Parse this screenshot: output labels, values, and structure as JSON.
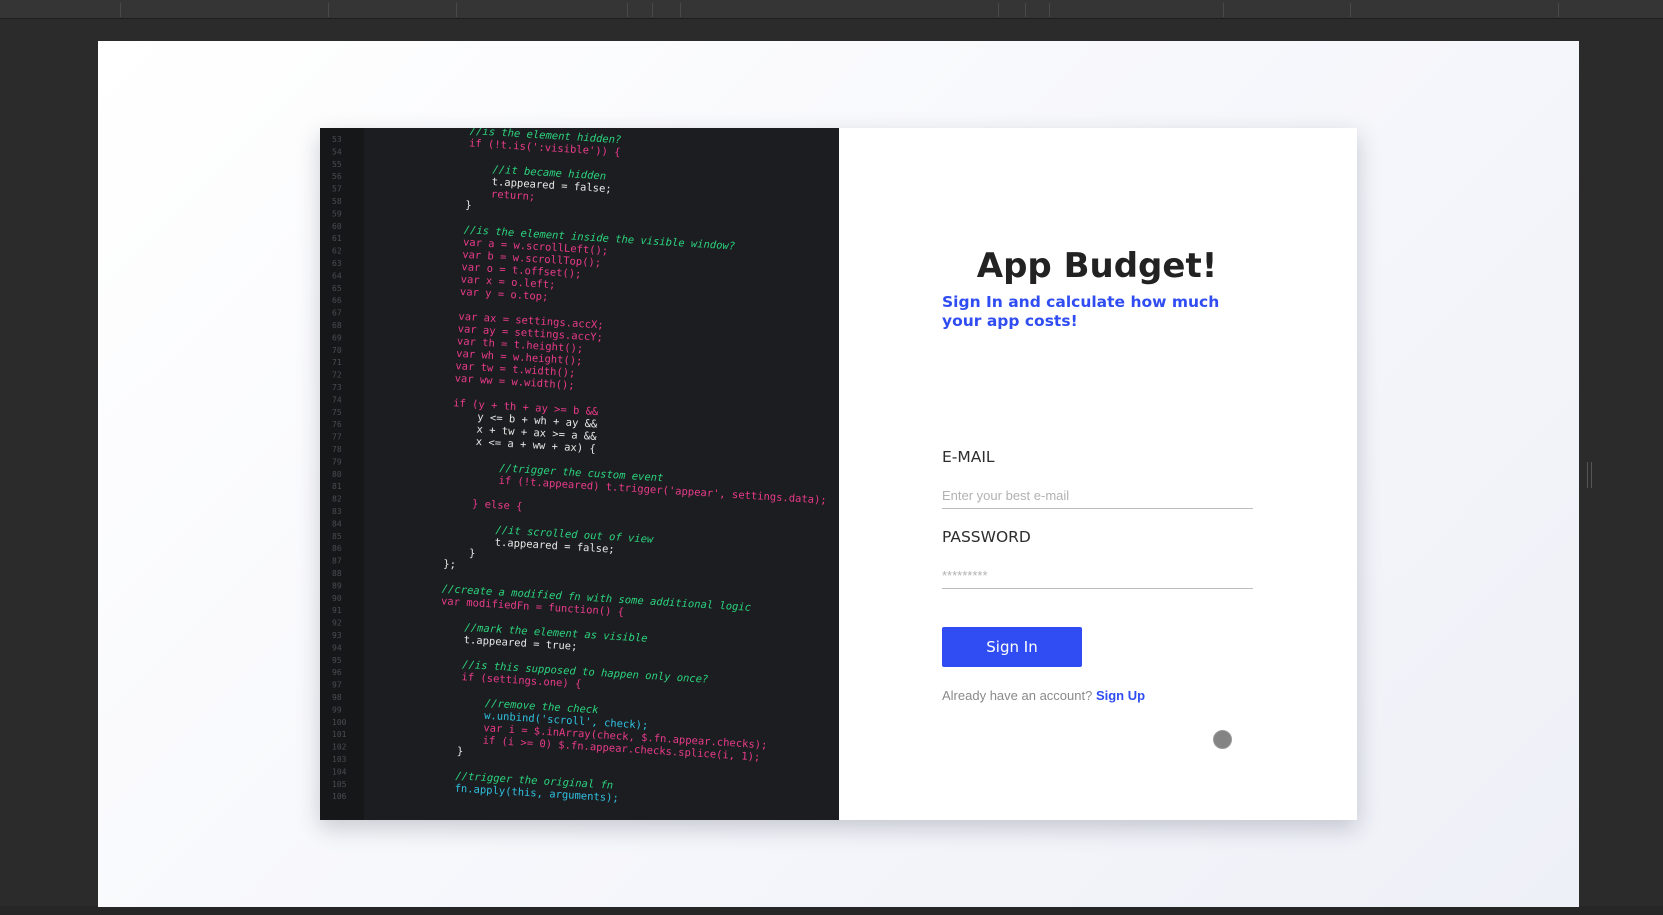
{
  "login": {
    "title": "App Budget!",
    "subtitle": "Sign In and calculate how much your app costs!",
    "email_label": "E-MAIL",
    "email_placeholder": "Enter your best e-mail",
    "email_value": "",
    "password_label": "PASSWORD",
    "password_placeholder": "*********",
    "password_value": "",
    "submit_label": "Sign In",
    "footer_text": "Already have an account?",
    "footer_link": "Sign Up"
  },
  "code_image": {
    "description_icon": "code-screenshot",
    "lines": [
      {
        "t": "//is the element hidden?",
        "c": "cm",
        "i": 0
      },
      {
        "t": "if (!t.is(':visible')) {",
        "c": "kw",
        "i": 0
      },
      {
        "t": "",
        "c": "tx",
        "i": 0
      },
      {
        "t": "//it became hidden",
        "c": "cm",
        "i": 1
      },
      {
        "t": "t.appeared = false;",
        "c": "tx",
        "i": 1
      },
      {
        "t": "return;",
        "c": "kw",
        "i": 1
      },
      {
        "t": "}",
        "c": "tx",
        "i": 0
      },
      {
        "t": "",
        "c": "tx",
        "i": 0
      },
      {
        "t": "//is the element inside the visible window?",
        "c": "cm",
        "i": 0
      },
      {
        "t": "var a = w.scrollLeft();",
        "c": "kw",
        "i": 0
      },
      {
        "t": "var b = w.scrollTop();",
        "c": "kw",
        "i": 0
      },
      {
        "t": "var o = t.offset();",
        "c": "kw",
        "i": 0
      },
      {
        "t": "var x = o.left;",
        "c": "kw",
        "i": 0
      },
      {
        "t": "var y = o.top;",
        "c": "kw",
        "i": 0
      },
      {
        "t": "",
        "c": "tx",
        "i": 0
      },
      {
        "t": "var ax = settings.accX;",
        "c": "kw",
        "i": 0
      },
      {
        "t": "var ay = settings.accY;",
        "c": "kw",
        "i": 0
      },
      {
        "t": "var th = t.height();",
        "c": "kw",
        "i": 0
      },
      {
        "t": "var wh = w.height();",
        "c": "kw",
        "i": 0
      },
      {
        "t": "var tw = t.width();",
        "c": "kw",
        "i": 0
      },
      {
        "t": "var ww = w.width();",
        "c": "kw",
        "i": 0
      },
      {
        "t": "",
        "c": "tx",
        "i": 0
      },
      {
        "t": "if (y + th + ay >= b &&",
        "c": "kw",
        "i": 0
      },
      {
        "t": "y <= b + wh + ay &&",
        "c": "tx",
        "i": 1
      },
      {
        "t": "x + tw + ax >= a &&",
        "c": "tx",
        "i": 1
      },
      {
        "t": "x <= a + ww + ax) {",
        "c": "tx",
        "i": 1
      },
      {
        "t": "",
        "c": "tx",
        "i": 0
      },
      {
        "t": "//trigger the custom event",
        "c": "cm",
        "i": 2
      },
      {
        "t": "if (!t.appeared) t.trigger('appear', settings.data);",
        "c": "kw",
        "i": 2
      },
      {
        "t": "",
        "c": "tx",
        "i": 0
      },
      {
        "t": "} else {",
        "c": "kw",
        "i": 1
      },
      {
        "t": "",
        "c": "tx",
        "i": 0
      },
      {
        "t": "//it scrolled out of view",
        "c": "cm",
        "i": 2
      },
      {
        "t": "t.appeared = false;",
        "c": "tx",
        "i": 2
      },
      {
        "t": "}",
        "c": "tx",
        "i": 1
      },
      {
        "t": "};",
        "c": "tx",
        "i": 0
      },
      {
        "t": "",
        "c": "tx",
        "i": 0
      },
      {
        "t": "//create a modified fn with some additional logic",
        "c": "cm",
        "i": 0
      },
      {
        "t": "var modifiedFn = function() {",
        "c": "kw",
        "i": 0
      },
      {
        "t": "",
        "c": "tx",
        "i": 0
      },
      {
        "t": "//mark the element as visible",
        "c": "cm",
        "i": 1
      },
      {
        "t": "t.appeared = true;",
        "c": "tx",
        "i": 1
      },
      {
        "t": "",
        "c": "tx",
        "i": 0
      },
      {
        "t": "//is this supposed to happen only once?",
        "c": "cm",
        "i": 1
      },
      {
        "t": "if (settings.one) {",
        "c": "kw",
        "i": 1
      },
      {
        "t": "",
        "c": "tx",
        "i": 0
      },
      {
        "t": "//remove the check",
        "c": "cm",
        "i": 2
      },
      {
        "t": "w.unbind('scroll', check);",
        "c": "fn",
        "i": 2
      },
      {
        "t": "var i = $.inArray(check, $.fn.appear.checks);",
        "c": "kw",
        "i": 2
      },
      {
        "t": "if (i >= 0) $.fn.appear.checks.splice(i, 1);",
        "c": "kw",
        "i": 2
      },
      {
        "t": "}",
        "c": "tx",
        "i": 1
      },
      {
        "t": "",
        "c": "tx",
        "i": 0
      },
      {
        "t": "//trigger the original fn",
        "c": "cm",
        "i": 1
      },
      {
        "t": "fn.apply(this, arguments);",
        "c": "fn",
        "i": 1
      }
    ],
    "colors": {
      "cm": "#2bd47e",
      "kw": "#e83b8a",
      "fn": "#2fc0e0",
      "tx": "#e8e8e8",
      "str": "#ff4a3a",
      "num": "#9a9ad8",
      "gutter": "#4a4c50"
    }
  },
  "theme": {
    "accent": "#2f4df2",
    "title_color": "#222222"
  }
}
